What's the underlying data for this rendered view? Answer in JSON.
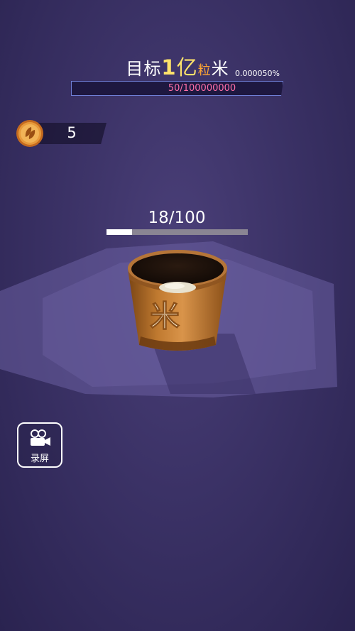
{
  "goal": {
    "prefix": "目标",
    "number": "1",
    "unit_big": "亿",
    "unit_grain": "粒",
    "suffix": "米",
    "percent": "0.000050%",
    "progress_text": "50/100000000",
    "progress_fraction": 5e-07
  },
  "coins": {
    "icon": "coin-seed-icon",
    "value": "5"
  },
  "bucket": {
    "progress_text": "18/100",
    "progress_fraction": 0.18,
    "label": "米",
    "icon": "rice-bucket"
  },
  "record": {
    "icon": "camera-icon",
    "label": "录屏"
  },
  "colors": {
    "background": "#3b3266",
    "goal_highlight": "#ffe36b",
    "grain_orange": "#ffa633",
    "goal_progress_text": "#ff6fa8",
    "bucket_bar_track": "#8a8593",
    "bucket_bar_fill": "#ffffff",
    "bucket_wood": "#b0702a"
  }
}
